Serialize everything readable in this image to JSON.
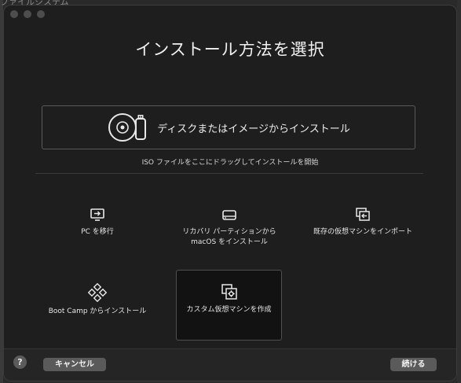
{
  "background_window": {
    "title_fragment": "ファイルシステム"
  },
  "dialog": {
    "title": "インストール方法を選択",
    "primary_option": {
      "label": "ディスクまたはイメージからインストール",
      "icon": "disc-and-usb-icon"
    },
    "drop_hint": "ISO ファイルをここにドラッグしてインストールを開始",
    "options": [
      {
        "id": "migrate-pc",
        "label": "PC を移行",
        "icon": "monitor-arrow-icon",
        "selected": false
      },
      {
        "id": "recovery",
        "label": "リカバリ パーティションから\nmacOS をインストール",
        "icon": "hard-drive-icon",
        "selected": false
      },
      {
        "id": "import",
        "label": "既存の仮想マシンをインポート",
        "icon": "import-window-icon",
        "selected": false
      },
      {
        "id": "bootcamp",
        "label": "Boot Camp からインストール",
        "icon": "bootcamp-diamond-icon",
        "selected": false
      },
      {
        "id": "custom",
        "label": "カスタム仮想マシンを作成",
        "icon": "custom-vm-gear-icon",
        "selected": true
      }
    ]
  },
  "footer": {
    "help_label": "?",
    "cancel_label": "キャンセル",
    "continue_label": "続ける"
  },
  "colors": {
    "window_bg": "#1e1e1e",
    "selected_bg": "#121212",
    "button_bg": "#5a5a5a",
    "border": "#5a5a5a"
  }
}
